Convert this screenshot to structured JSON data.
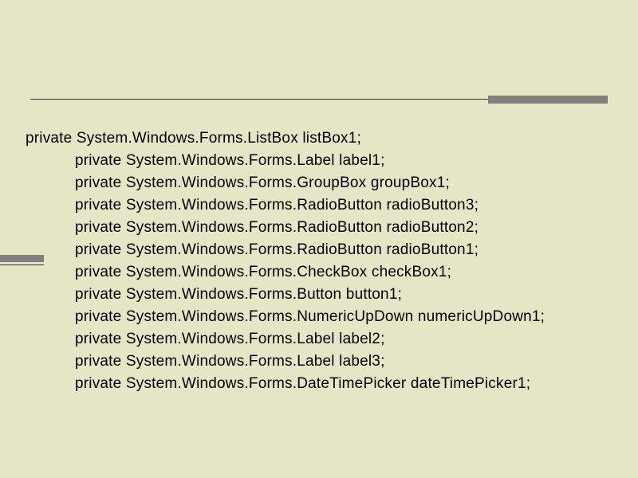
{
  "code": {
    "lines": [
      {
        "indent": false,
        "text": "private System.Windows.Forms.ListBox listBox1;"
      },
      {
        "indent": true,
        "text": "private System.Windows.Forms.Label label1;"
      },
      {
        "indent": true,
        "text": "private System.Windows.Forms.GroupBox groupBox1;"
      },
      {
        "indent": true,
        "text": "private System.Windows.Forms.RadioButton radioButton3;"
      },
      {
        "indent": true,
        "text": "private System.Windows.Forms.RadioButton radioButton2;"
      },
      {
        "indent": true,
        "text": "private System.Windows.Forms.RadioButton radioButton1;"
      },
      {
        "indent": true,
        "text": "private System.Windows.Forms.CheckBox checkBox1;"
      },
      {
        "indent": true,
        "text": "private System.Windows.Forms.Button button1;"
      },
      {
        "indent": true,
        "text": "private System.Windows.Forms.NumericUpDown numericUpDown1;"
      },
      {
        "indent": true,
        "text": "private System.Windows.Forms.Label label2;"
      },
      {
        "indent": true,
        "text": "private System.Windows.Forms.Label label3;"
      },
      {
        "indent": true,
        "text": "private System.Windows.Forms.DateTimePicker dateTimePicker1;"
      }
    ]
  }
}
